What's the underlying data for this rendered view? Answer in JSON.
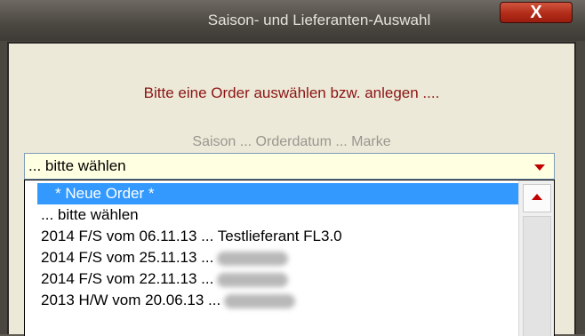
{
  "window": {
    "title": "Saison- und Lieferanten-Auswahl",
    "close_label": "X"
  },
  "prompt": "Bitte eine Order auswählen bzw. anlegen ....",
  "subheading": "Saison ... Orderdatum ... Marke",
  "combo": {
    "value": "... bitte wählen",
    "icon": "dropdown-arrow-icon"
  },
  "dropdown": {
    "items": [
      {
        "label": "* Neue Order *",
        "selected": true
      },
      {
        "label": "... bitte wählen"
      },
      {
        "label": "2014 F/S vom 06.11.13 ... Testlieferant FL3.0"
      },
      {
        "label": "2014 F/S vom 25.11.13 ...",
        "redacted": true
      },
      {
        "label": "2014 F/S vom 22.11.13 ...",
        "redacted": true
      },
      {
        "label": "2013 H/W vom 20.06.13 ...",
        "redacted": true
      }
    ]
  },
  "colors": {
    "prompt": "#8b1414",
    "selection": "#3399ff",
    "arrow": "#c00000"
  }
}
